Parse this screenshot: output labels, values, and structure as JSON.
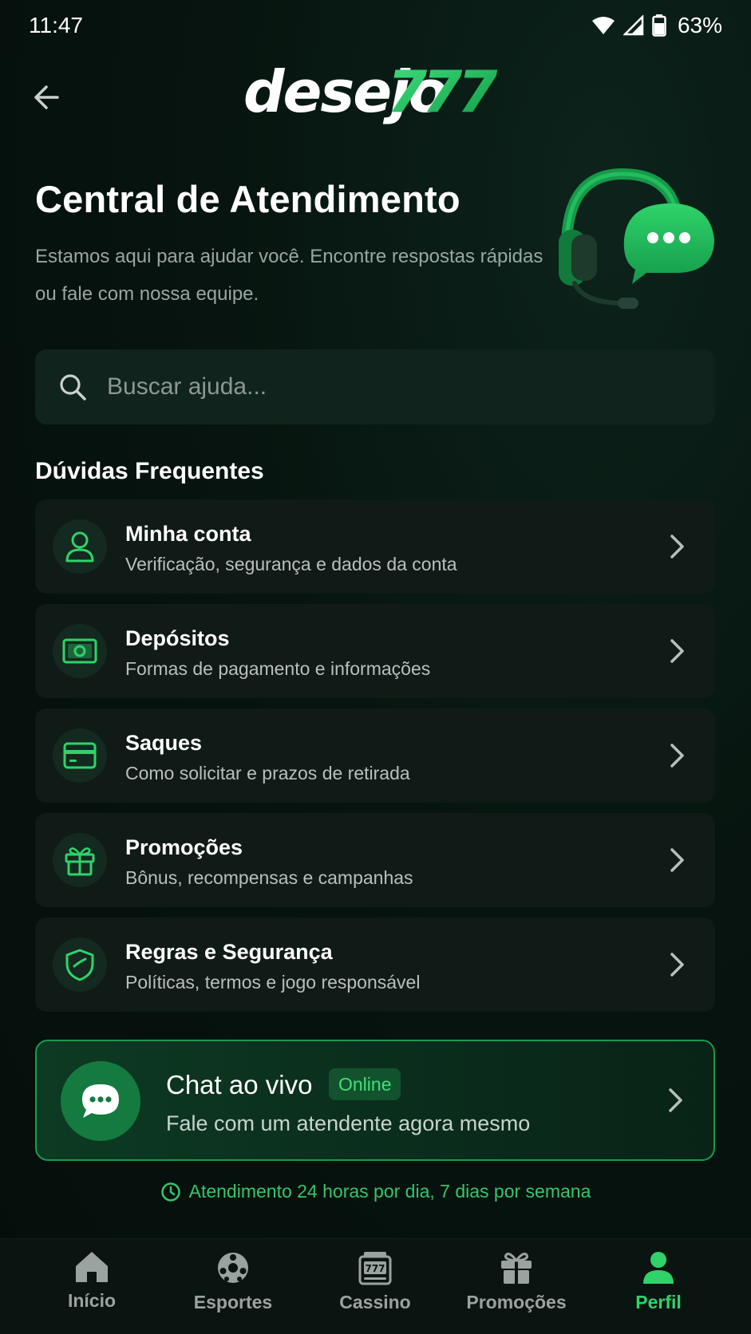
{
  "status_bar": {
    "time": "11:47",
    "battery": "63%",
    "icons": [
      "wifi-icon",
      "signal-icon",
      "battery-icon"
    ]
  },
  "header": {
    "back_icon": "arrow-left-icon",
    "logo_text": "desejo",
    "logo_number": "777"
  },
  "hero": {
    "title": "Central de Atendimento",
    "subtitle": "Estamos aqui para ajudar você. Encontre respostas rápidas ou fale com nossa equipe.",
    "illustration": "headset-chat-icon"
  },
  "search": {
    "placeholder": "Buscar ajuda...",
    "value": ""
  },
  "faq": {
    "heading": "Dúvidas Frequentes",
    "items": [
      {
        "title": "Minha conta",
        "description": "Verificação, segurança e dados da conta",
        "icon": "user-icon"
      },
      {
        "title": "Depósitos",
        "description": "Formas de pagamento e informações",
        "icon": "cash-icon"
      },
      {
        "title": "Saques",
        "description": "Como solicitar e prazos de retirada",
        "icon": "card-icon"
      },
      {
        "title": "Promoções",
        "description": "Bônus, recompensas e campanhas",
        "icon": "gift-icon"
      },
      {
        "title": "Regras e Segurança",
        "description": "Políticas, termos e jogo responsável",
        "icon": "shield-icon"
      }
    ]
  },
  "live_chat": {
    "title": "Chat ao vivo",
    "badge": "Online",
    "description": "Fale com um atendente agora mesmo"
  },
  "support_hours": "Atendimento 24 horas por dia, 7 dias por semana",
  "bottom_nav": {
    "items": [
      {
        "label": "Início",
        "icon": "home-icon",
        "active": false
      },
      {
        "label": "Esportes",
        "icon": "soccer-ball-icon",
        "active": false
      },
      {
        "label": "Cassino",
        "icon": "slot-machine-icon",
        "active": false
      },
      {
        "label": "Promoções",
        "icon": "gift-icon",
        "active": false
      },
      {
        "label": "Perfil",
        "icon": "profile-icon",
        "active": true
      }
    ]
  },
  "colors": {
    "accent": "#2fd36a",
    "background": "#06120f",
    "card": "#101a17"
  }
}
